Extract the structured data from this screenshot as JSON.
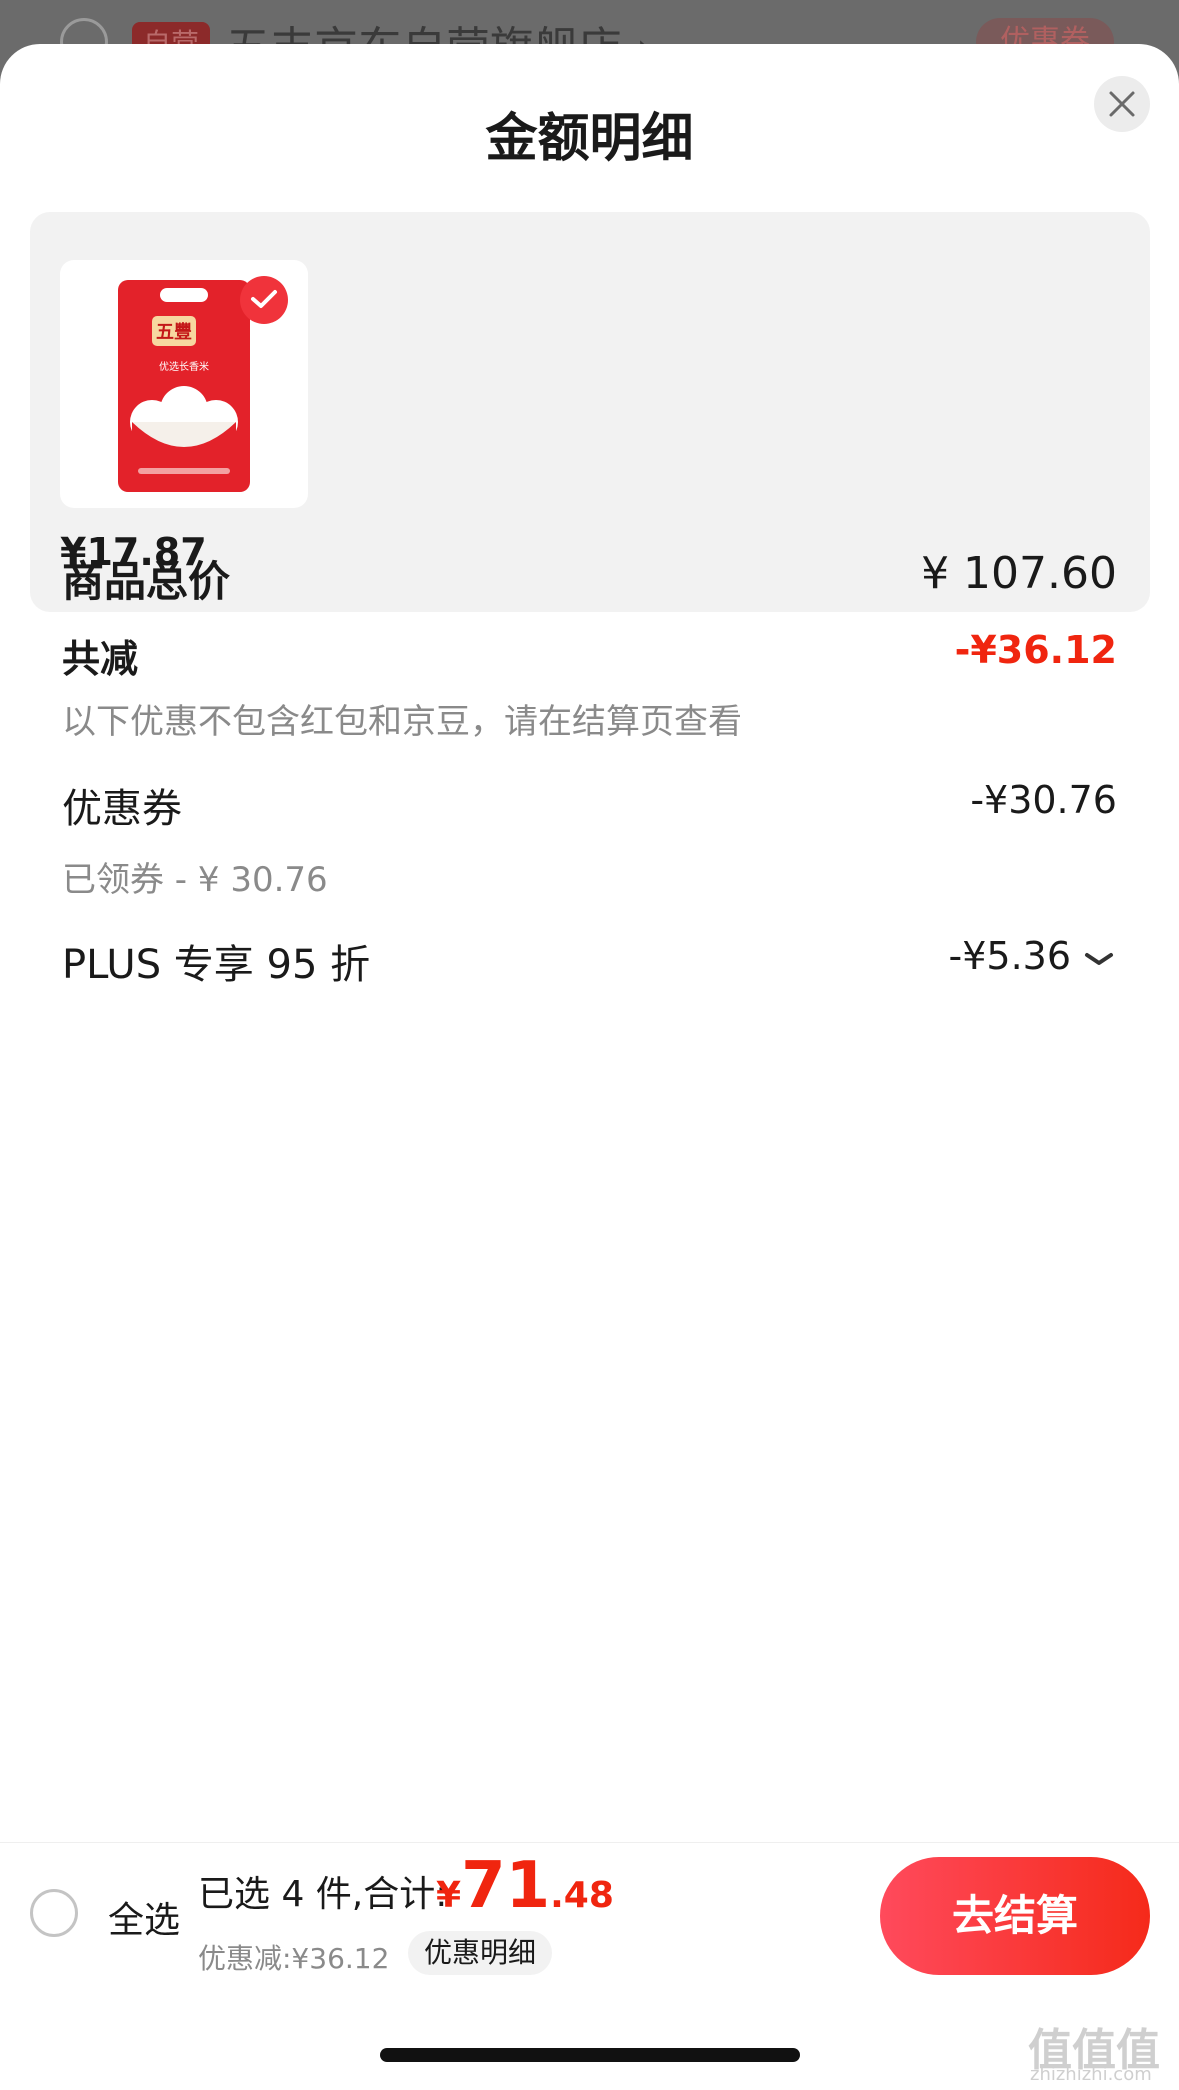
{
  "background_store": {
    "badge": "自营",
    "store_name": "五丰京东自营旗舰店 ›",
    "coupon_label": "优惠券"
  },
  "sheet": {
    "title": "金额明细",
    "close_icon": "close-icon"
  },
  "product": {
    "price": "¥17.87",
    "selected": true,
    "image_icon": "rice-bag-image"
  },
  "breakdown": {
    "total_label": "商品总价",
    "total_value": "¥ 107.60",
    "reduction_label": "共减",
    "reduction_value": "-¥36.12",
    "reduction_note": "以下优惠不包含红包和京豆，请在结算页查看",
    "coupon_label": "优惠券",
    "coupon_value": "-¥30.76",
    "coupon_note": "已领券 - ¥ 30.76",
    "plus_label": "PLUS 专享 95 折",
    "plus_value": "-¥5.36"
  },
  "footer": {
    "select_all": "全选",
    "selected_text": "已选 4 件,合计:",
    "price_currency": "¥",
    "price_int": "71",
    "price_dec": ".48",
    "discount_text": "优惠减:¥36.12",
    "detail_chip": "优惠明细",
    "checkout": "去结算"
  },
  "watermark": {
    "text": "值值值",
    "sub": "zhizhizhi.com"
  },
  "colors": {
    "accent_red": "#f0250f",
    "check_red": "#f0333b",
    "button_gradient_start": "#ff4a5c",
    "button_gradient_end": "#f52a1a"
  }
}
